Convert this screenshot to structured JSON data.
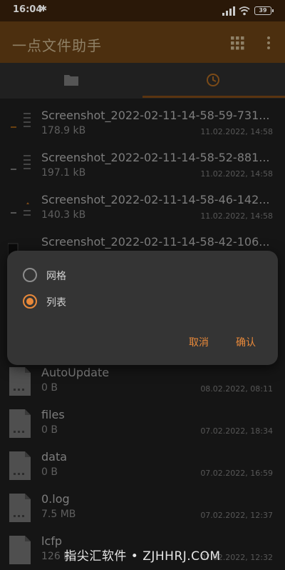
{
  "status": {
    "time": "16:04",
    "battery": "39",
    "signal": "4G+"
  },
  "app": {
    "title": "一点文件助手"
  },
  "tabs": [
    {
      "icon": "folder-icon"
    },
    {
      "icon": "clock-icon",
      "active": true
    }
  ],
  "recent_files": [
    {
      "name": "Screenshot_2022-02-11-14-58-59-731...",
      "size": "178.9 kB",
      "date": "11.02.2022, 14:58"
    },
    {
      "name": "Screenshot_2022-02-11-14-58-52-881...",
      "size": "197.1 kB",
      "date": "11.02.2022, 14:58"
    },
    {
      "name": "Screenshot_2022-02-11-14-58-46-142...",
      "size": "140.3 kB",
      "date": "11.02.2022, 14:58"
    },
    {
      "name": "Screenshot_2022-02-11-14-58-42-106..."
    }
  ],
  "files": [
    {
      "name": "AutoUpdate",
      "size": "0 B",
      "date": "08.02.2022, 08:11"
    },
    {
      "name": "files",
      "size": "0 B",
      "date": "07.02.2022, 18:34"
    },
    {
      "name": "data",
      "size": "0 B",
      "date": "07.02.2022, 16:59"
    },
    {
      "name": "0.log",
      "size": "7.5 MB",
      "date": "07.02.2022, 12:37"
    },
    {
      "name": "lcfp",
      "size": "126 B",
      "date": "07.02.2022, 12:32"
    }
  ],
  "dialog": {
    "options": [
      {
        "label": "网格",
        "checked": false
      },
      {
        "label": "列表",
        "checked": true
      }
    ],
    "cancel_label": "取消",
    "ok_label": "确认"
  },
  "watermark": "指尖汇软件 • ZJHHRJ.COM",
  "colors": {
    "accent": "#e8893a",
    "appbar": "#4c2f0f",
    "dialog": "#343434"
  }
}
